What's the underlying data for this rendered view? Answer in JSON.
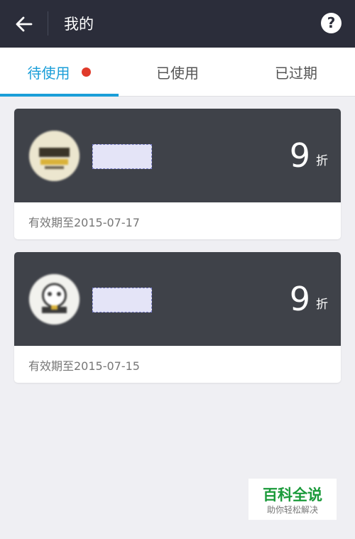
{
  "header": {
    "title": "我的",
    "help_symbol": "?"
  },
  "tabs": [
    {
      "label": "待使用",
      "active": true,
      "has_dot": true
    },
    {
      "label": "已使用",
      "active": false
    },
    {
      "label": "已过期",
      "active": false
    }
  ],
  "coupons": [
    {
      "discount": "9",
      "unit": "折",
      "validity": "有效期至2015-07-17"
    },
    {
      "discount": "9",
      "unit": "折",
      "validity": "有效期至2015-07-15"
    }
  ],
  "watermark": {
    "title": "百科全说",
    "subtitle": "助你轻松解决"
  },
  "colors": {
    "header_bg": "#2b2d3a",
    "accent": "#1a9ed8",
    "dot": "#e03a2a",
    "card_top": "#3f4249"
  }
}
